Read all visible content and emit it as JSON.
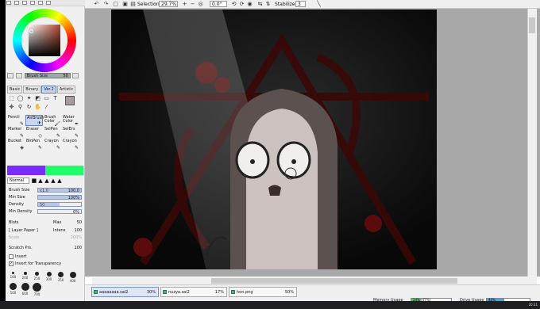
{
  "toolbar": {
    "selection_label": "Selection",
    "zoom": "29.7%",
    "rotation": "0.0°",
    "stabilizer_label": "Stabilizer",
    "stabilizer_value": "3"
  },
  "brush_size": {
    "label": "Brush Size",
    "value": "50"
  },
  "tool_tabs": [
    "Basic",
    "Binary",
    "Ver.2",
    "Artistic"
  ],
  "brushes": [
    {
      "label": "Pencil",
      "icon": "✎"
    },
    {
      "label": "AirBrush",
      "icon": "✈"
    },
    {
      "label": "Brush Color",
      "icon": "🖌"
    },
    {
      "label": "Water Color",
      "icon": "✒"
    },
    {
      "label": "Marker",
      "icon": "✎"
    },
    {
      "label": "Eraser",
      "icon": "◇"
    },
    {
      "label": "SelPen",
      "icon": "✎"
    },
    {
      "label": "SelErs",
      "icon": "✎"
    },
    {
      "label": "Bucket",
      "icon": "◈"
    },
    {
      "label": "BinPen",
      "icon": "✎"
    },
    {
      "label": "Crayon",
      "icon": "✎"
    },
    {
      "label": "Crayon",
      "icon": "✎"
    }
  ],
  "colors": {
    "primary": "#7a2bff",
    "secondary": "#20ff6a",
    "current": "#a69c98"
  },
  "blend_mode": "Normal",
  "params": {
    "brush_size_label": "Brush Size",
    "brush_size_mult": "x1.0",
    "brush_size_value": "100.0",
    "min_size_label": "Min Size",
    "min_size_value": "100%",
    "density_label": "Density",
    "density_value": "50",
    "min_density_label": "Min Density",
    "min_density_value": "0%"
  },
  "options": {
    "blots_label": "Blots",
    "blots_sub": "Max",
    "blots_value": "50",
    "texture_label": "[ Layer Paper ]",
    "texture_sub": "Intens",
    "texture_value": "100",
    "scale_label": "Scale",
    "scale_value": "200%",
    "scratch_label": "Scratch Prs.",
    "scratch_value": "100",
    "invert_label": "Invert",
    "invert_transparency_label": "Invert for Transparency"
  },
  "brush_dots": [
    "160",
    "200",
    "250",
    "300",
    "350",
    "400",
    "500",
    "600",
    "700"
  ],
  "tasks": [
    {
      "name": "aaaaaaaa.sai2",
      "zoom": "30%"
    },
    {
      "name": "nuzya.sai2",
      "zoom": "17%"
    },
    {
      "name": "hon.png",
      "zoom": "50%"
    }
  ],
  "memory": {
    "label": "Memory Usage",
    "text": "24% (47%)",
    "percent": 24
  },
  "drive": {
    "label": "Drive Usage",
    "text": "40%",
    "percent": 40
  },
  "clock": "20:31"
}
